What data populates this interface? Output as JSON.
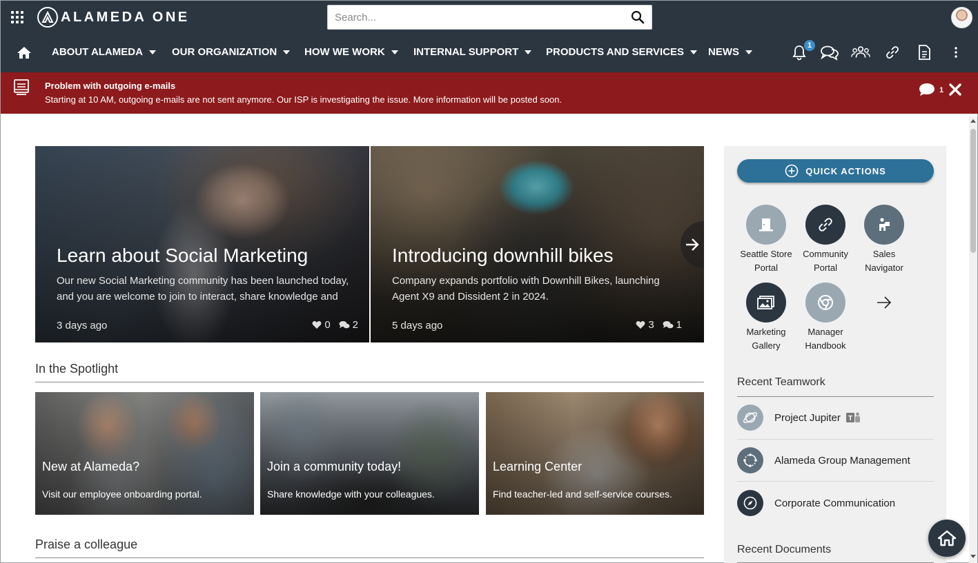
{
  "app": {
    "name": "ALAMEDA ONE"
  },
  "search": {
    "placeholder": "Search..."
  },
  "nav": {
    "items": [
      {
        "label": "ABOUT ALAMEDA"
      },
      {
        "label": "OUR ORGANIZATION"
      },
      {
        "label": "HOW WE WORK"
      },
      {
        "label": "INTERNAL SUPPORT"
      },
      {
        "label": "PRODUCTS AND SERVICES"
      },
      {
        "label": "NEWS"
      }
    ],
    "notifications_count": "1",
    "icons": [
      "home-icon",
      "bell-icon",
      "chat-icon",
      "people-icon",
      "link-icon",
      "document-icon",
      "more-vertical-icon"
    ]
  },
  "alert": {
    "title": "Problem with outgoing e-mails",
    "text": "Starting at 10 AM, outgoing e-mails are not sent anymore. Our ISP is investigating the issue. More information will be posted soon.",
    "comment_count": "1",
    "background": "#8d1a1c"
  },
  "hero": [
    {
      "title": "Learn about Social Marketing",
      "description": "Our new Social Marketing community has been launched today, and you are welcome to join to interact, share knowledge and",
      "time": "3 days ago",
      "likes": "0",
      "comments": "2"
    },
    {
      "title": "Introducing downhill bikes",
      "description": "Company expands portfolio with Downhill Bikes, launching Agent X9 and Dissident 2 in 2024.",
      "time": "5 days ago",
      "likes": "3",
      "comments": "1"
    }
  ],
  "spotlight": {
    "title": "In the Spotlight",
    "tiles": [
      {
        "title": "New at Alameda?",
        "description": "Visit our employee onboarding portal."
      },
      {
        "title": "Join a community today!",
        "description": "Share knowledge with your colleagues."
      },
      {
        "title": "Learning Center",
        "description": "Find teacher-led and self-service courses."
      }
    ]
  },
  "praise": {
    "title": "Praise a colleague"
  },
  "quick_actions": {
    "button_label": "QUICK ACTIONS",
    "items": [
      {
        "label_line1": "Seattle Store",
        "label_line2": "Portal",
        "icon": "door-icon",
        "color": "#9aa8b2"
      },
      {
        "label_line1": "Community",
        "label_line2": "Portal",
        "icon": "link-icon",
        "color": "#2b3641"
      },
      {
        "label_line1": "Sales",
        "label_line2": "Navigator",
        "icon": "presenter-icon",
        "color": "#5e6f7c"
      },
      {
        "label_line1": "Marketing",
        "label_line2": "Gallery",
        "icon": "gallery-icon",
        "color": "#2b3641"
      },
      {
        "label_line1": "Manager",
        "label_line2": "Handbook",
        "icon": "chrome-icon",
        "color": "#9aa8b2"
      }
    ]
  },
  "recent_teamwork": {
    "title": "Recent Teamwork",
    "items": [
      {
        "label": "Project Jupiter",
        "icon": "planet-icon",
        "color": "#9aa8b2"
      },
      {
        "label": "Alameda Group Management",
        "icon": "cycle-icon",
        "color": "#5e6f7c"
      },
      {
        "label": "Corporate Communication",
        "icon": "compass-icon",
        "color": "#2b3641"
      }
    ]
  },
  "recent_documents": {
    "title": "Recent Documents"
  },
  "colors": {
    "topbar": "#2b3641",
    "accent": "#2d7198",
    "badge": "#3a8fc7"
  }
}
